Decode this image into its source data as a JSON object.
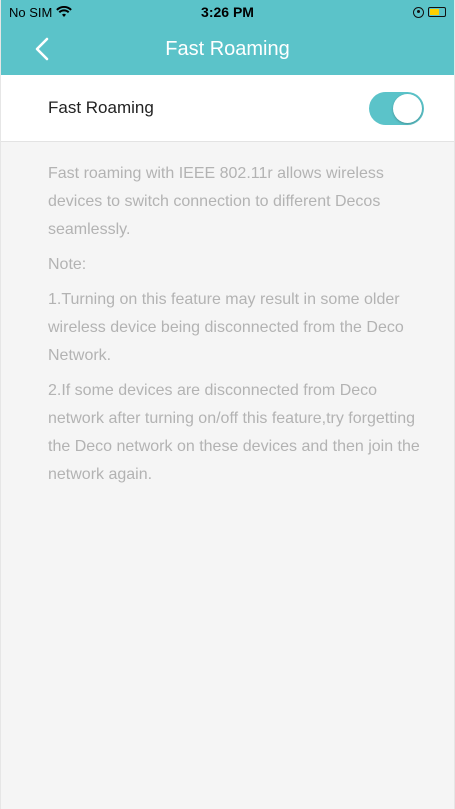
{
  "status_bar": {
    "carrier": "No SIM",
    "time": "3:26 PM"
  },
  "nav": {
    "title": "Fast Roaming",
    "back_icon": "chevron-left-icon"
  },
  "setting": {
    "label": "Fast Roaming",
    "enabled": true,
    "accent_color": "#5bc3c9"
  },
  "description": {
    "intro": "Fast roaming with IEEE 802.11r allows wireless devices to switch connection to different Decos seamlessly.",
    "note_label": "Note:",
    "note_1": "1.Turning on this feature may result in some older wireless device being disconnected  from the Deco Network.",
    "note_2": "2.If some devices are disconnected from Deco network after turning on/off this feature,try forgetting the Deco network on these devices and then join the network again."
  }
}
